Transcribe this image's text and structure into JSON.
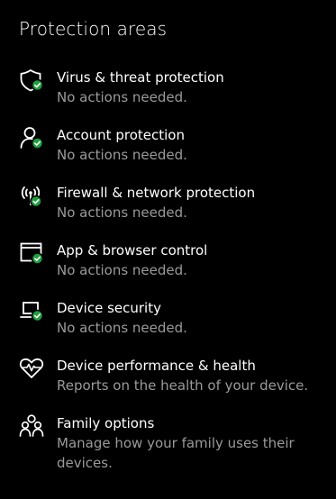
{
  "section": {
    "title": "Protection areas"
  },
  "items": [
    {
      "label": "Virus & threat protection",
      "description": "No actions needed.",
      "icon": "shield-icon",
      "status": "ok"
    },
    {
      "label": "Account protection",
      "description": "No actions needed.",
      "icon": "person-icon",
      "status": "ok"
    },
    {
      "label": "Firewall & network protection",
      "description": "No actions needed.",
      "icon": "wireless-antenna-icon",
      "status": "ok"
    },
    {
      "label": "App & browser control",
      "description": "No actions needed.",
      "icon": "browser-window-icon",
      "status": "ok"
    },
    {
      "label": "Device security",
      "description": "No actions needed.",
      "icon": "laptop-icon",
      "status": "ok"
    },
    {
      "label": "Device performance & health",
      "description": "Reports on the health of your device.",
      "icon": "heart-pulse-icon"
    },
    {
      "label": "Family options",
      "description": "Manage how your family uses their devices.",
      "icon": "family-icon"
    }
  ],
  "colors": {
    "background": "#000000",
    "text": "#ffffff",
    "secondary_text": "#9a9a9a",
    "status_ok": "#1f9e3f"
  }
}
